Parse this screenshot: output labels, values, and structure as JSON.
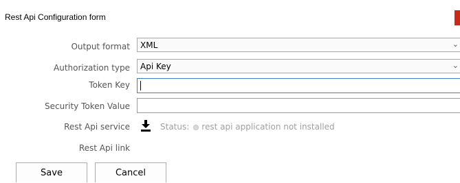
{
  "window": {
    "title": "Rest Api Configuration form"
  },
  "form": {
    "output_format": {
      "label": "Output format",
      "value": "XML"
    },
    "authorization_type": {
      "label": "Authorization type",
      "value": "Api Key"
    },
    "token_key": {
      "label": "Token Key",
      "value": ""
    },
    "security_token_value": {
      "label": "Security Token Value",
      "value": ""
    },
    "rest_api_service": {
      "label": "Rest Api service",
      "status_label": "Status:",
      "status_text": "rest api application not installed"
    },
    "rest_api_link": {
      "label": "Rest Api link"
    }
  },
  "buttons": {
    "save": "Save",
    "cancel": "Cancel"
  },
  "icons": {
    "download": "download-icon",
    "dropdown": "chevron-down-icon"
  },
  "colors": {
    "close_button": "#c42b1c",
    "focus_border": "#3a80c8"
  }
}
